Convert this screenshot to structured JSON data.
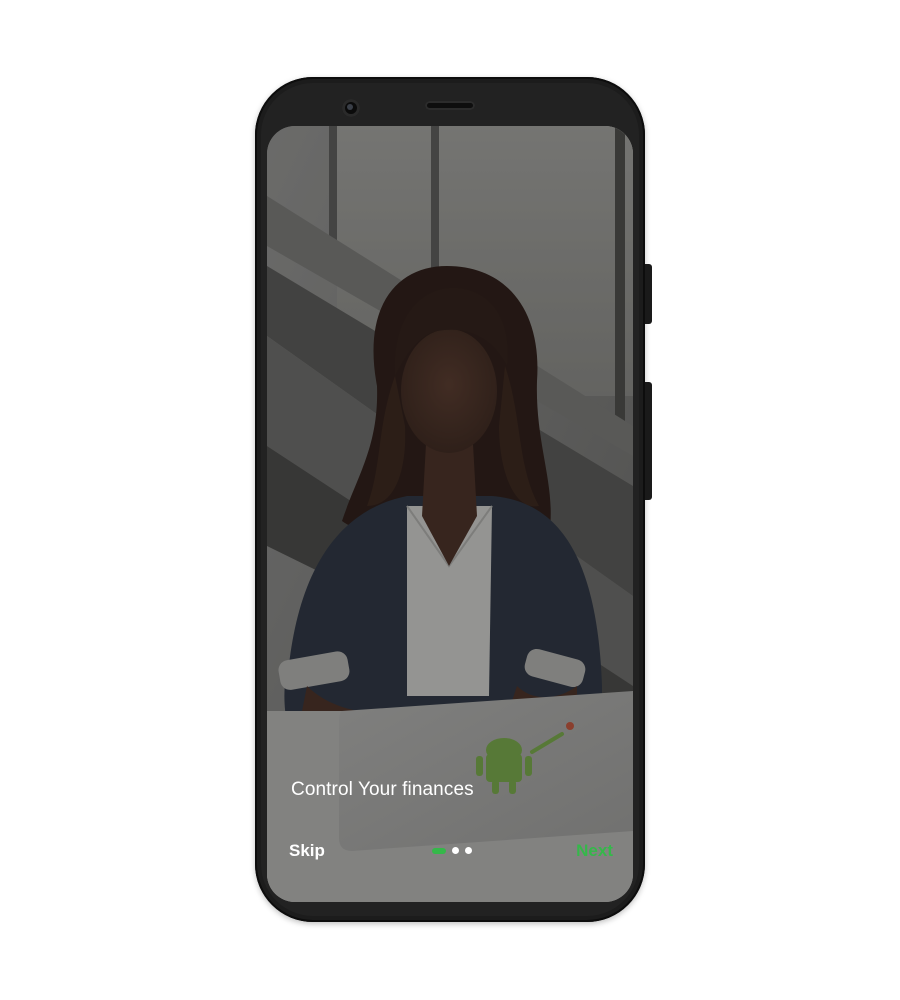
{
  "onboarding": {
    "headline": "Control Your finances",
    "skip_label": "Skip",
    "next_label": "Next",
    "pager": {
      "total": 3,
      "current": 1
    }
  },
  "colors": {
    "accent": "#35b84a",
    "text_on_image": "#ffffff",
    "phone_body": "#1c1c1c",
    "page_background": "#ffffff"
  },
  "background_image": "photo-woman-working-on-laptop"
}
